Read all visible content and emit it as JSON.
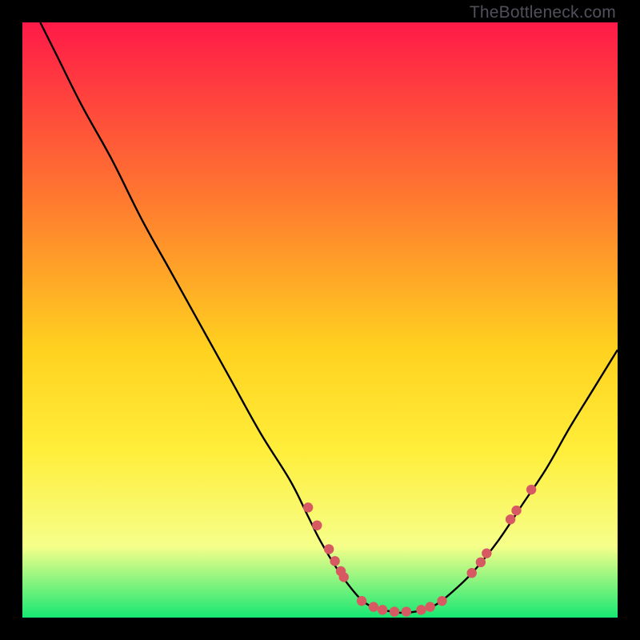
{
  "watermark": "TheBottleneck.com",
  "colors": {
    "gradient_top": "#ff1a48",
    "gradient_mid_upper": "#ff7a2f",
    "gradient_mid": "#ffd21f",
    "gradient_mid_lower": "#ffee3a",
    "gradient_low": "#f6ff8a",
    "gradient_bottom": "#17e873",
    "curve": "#000000",
    "marker": "#d75a62",
    "background": "#000000"
  },
  "chart_data": {
    "type": "line",
    "title": "",
    "xlabel": "",
    "ylabel": "",
    "xlim": [
      0,
      100
    ],
    "ylim": [
      0,
      100
    ],
    "series": [
      {
        "name": "bottleneck-curve",
        "x": [
          3,
          6,
          10,
          15,
          20,
          25,
          30,
          35,
          40,
          45,
          48,
          50,
          53,
          56,
          58,
          60,
          62,
          64,
          66,
          68,
          70,
          73,
          76,
          80,
          84,
          88,
          92,
          96,
          100
        ],
        "y": [
          100,
          94,
          86,
          77,
          67,
          58,
          49,
          40,
          31,
          23,
          17,
          13,
          8,
          4,
          2.2,
          1.5,
          1.0,
          0.8,
          1.0,
          1.5,
          2.5,
          5,
          8,
          13,
          19,
          25,
          32,
          38.5,
          45
        ]
      }
    ],
    "markers": {
      "name": "highlight-points",
      "points": [
        {
          "x": 48.0,
          "y": 18.5
        },
        {
          "x": 49.5,
          "y": 15.5
        },
        {
          "x": 51.5,
          "y": 11.5
        },
        {
          "x": 52.5,
          "y": 9.5
        },
        {
          "x": 53.5,
          "y": 7.8
        },
        {
          "x": 54.0,
          "y": 6.8
        },
        {
          "x": 57.0,
          "y": 2.8
        },
        {
          "x": 59.0,
          "y": 1.8
        },
        {
          "x": 60.5,
          "y": 1.3
        },
        {
          "x": 62.5,
          "y": 1.0
        },
        {
          "x": 64.5,
          "y": 1.0
        },
        {
          "x": 67.0,
          "y": 1.3
        },
        {
          "x": 68.5,
          "y": 1.8
        },
        {
          "x": 70.5,
          "y": 2.8
        },
        {
          "x": 75.5,
          "y": 7.5
        },
        {
          "x": 77.0,
          "y": 9.3
        },
        {
          "x": 78.0,
          "y": 10.8
        },
        {
          "x": 82.0,
          "y": 16.5
        },
        {
          "x": 83.0,
          "y": 18.0
        },
        {
          "x": 85.5,
          "y": 21.5
        }
      ]
    },
    "gradient_stops": [
      {
        "offset": 0.0,
        "key": "gradient_top"
      },
      {
        "offset": 0.3,
        "key": "gradient_mid_upper"
      },
      {
        "offset": 0.55,
        "key": "gradient_mid"
      },
      {
        "offset": 0.72,
        "key": "gradient_mid_lower"
      },
      {
        "offset": 0.88,
        "key": "gradient_low"
      },
      {
        "offset": 1.0,
        "key": "gradient_bottom"
      }
    ]
  }
}
